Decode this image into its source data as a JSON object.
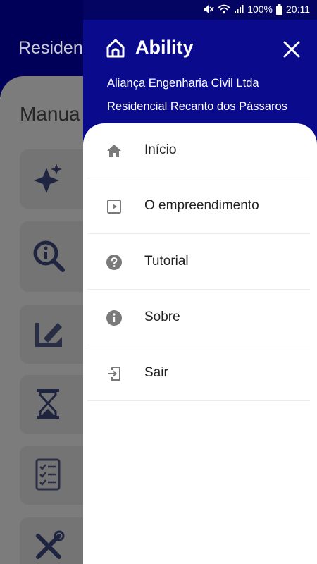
{
  "status_bar": {
    "battery_text": "100%",
    "time": "20:11"
  },
  "background": {
    "header_title": "Residen",
    "section_title": "Manua"
  },
  "drawer": {
    "app_name": "Ability",
    "company": "Aliança Engenharia Civil Ltda",
    "project": "Residencial Recanto dos Pássaros",
    "menu": [
      {
        "label": "Início",
        "icon": "home-icon"
      },
      {
        "label": "O empreendimento",
        "icon": "play-box-icon"
      },
      {
        "label": "Tutorial",
        "icon": "help-circle-icon"
      },
      {
        "label": "Sobre",
        "icon": "info-circle-icon"
      },
      {
        "label": "Sair",
        "icon": "exit-icon"
      }
    ]
  },
  "colors": {
    "primary": "#0a0a8c",
    "primary_dark": "#000058",
    "icon_gray": "#7a7a7a"
  }
}
